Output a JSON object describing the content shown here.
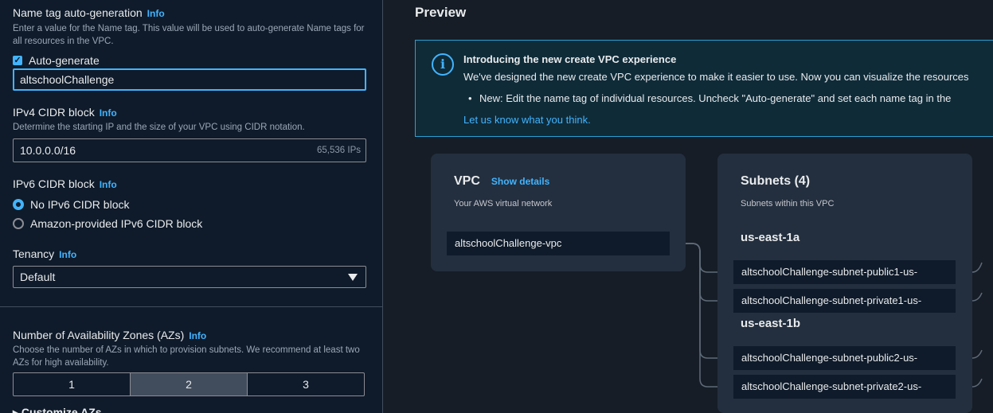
{
  "left": {
    "name_tag": {
      "label": "Name tag auto-generation",
      "info": "Info",
      "description": "Enter a value for the Name tag. This value will be used to auto-generate Name tags for all resources in the VPC.",
      "checkbox_label": "Auto-generate",
      "value": "altschoolChallenge"
    },
    "ipv4": {
      "label": "IPv4 CIDR block",
      "info": "Info",
      "description": "Determine the starting IP and the size of your VPC using CIDR notation.",
      "value": "10.0.0.0/16",
      "suffix": "65,536 IPs"
    },
    "ipv6": {
      "label": "IPv6 CIDR block",
      "info": "Info",
      "options": [
        "No IPv6 CIDR block",
        "Amazon-provided IPv6 CIDR block"
      ],
      "selected_index": 0
    },
    "tenancy": {
      "label": "Tenancy",
      "info": "Info",
      "value": "Default"
    },
    "azs": {
      "label": "Number of Availability Zones (AZs)",
      "info": "Info",
      "description": "Choose the number of AZs in which to provision subnets. We recommend at least two AZs for high availability.",
      "options": [
        "1",
        "2",
        "3"
      ],
      "selected": "2",
      "customize_label": "Customize AZs"
    }
  },
  "preview": {
    "title": "Preview",
    "banner": {
      "title": "Introducing the new create VPC experience",
      "text": "We've designed the new create VPC experience to make it easier to use. Now you can visualize the resources",
      "bullet": "New: Edit the name tag of individual resources. Uncheck \"Auto-generate\" and set each name tag in the",
      "link": "Let us know what you think."
    },
    "vpc_card": {
      "title": "VPC",
      "show_details": "Show details",
      "subtitle": "Your AWS virtual network",
      "resource": "altschoolChallenge-vpc"
    },
    "subnets_card": {
      "title": "Subnets (4)",
      "subtitle": "Subnets within this VPC",
      "zones": [
        {
          "name": "us-east-1a",
          "subnets": [
            "altschoolChallenge-subnet-public1-us-",
            "altschoolChallenge-subnet-private1-us-"
          ]
        },
        {
          "name": "us-east-1b",
          "subnets": [
            "altschoolChallenge-subnet-public2-us-",
            "altschoolChallenge-subnet-private2-us-"
          ]
        }
      ]
    }
  }
}
